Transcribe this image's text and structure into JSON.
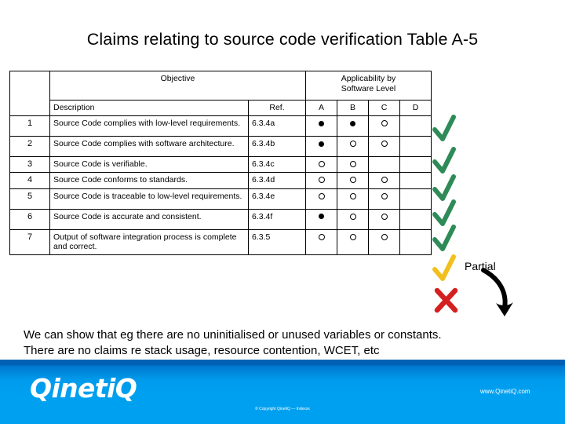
{
  "slide": {
    "title": "Claims relating to source code verification Table A-5"
  },
  "table": {
    "group_headers": {
      "objective": "Objective",
      "applicability_line1": "Applicability by",
      "applicability_line2": "Software Level"
    },
    "sub_headers": {
      "num": "",
      "description": "Description",
      "ref": "Ref.",
      "a": "A",
      "b": "B",
      "c": "C",
      "d": "D"
    },
    "rows": [
      {
        "num": "1",
        "description": "Source Code complies with low-level requirements.",
        "ref": "6.3.4a",
        "a": "filled",
        "b": "filled",
        "c": "open",
        "d": "none",
        "mark": "tick-green"
      },
      {
        "num": "2",
        "description": "Source Code complies with software architecture.",
        "ref": "6.3.4b",
        "a": "filled",
        "b": "open",
        "c": "open",
        "d": "none",
        "mark": "tick-green"
      },
      {
        "num": "3",
        "description": "Source Code is verifiable.",
        "ref": "6.3.4c",
        "a": "open",
        "b": "open",
        "c": "none",
        "d": "none",
        "mark": "tick-green"
      },
      {
        "num": "4",
        "description": "Source Code conforms to standards.",
        "ref": "6.3.4d",
        "a": "open",
        "b": "open",
        "c": "open",
        "d": "none",
        "mark": "tick-green"
      },
      {
        "num": "5",
        "description": "Source Code is traceable to low-level requirements.",
        "ref": "6.3.4e",
        "a": "open",
        "b": "open",
        "c": "open",
        "d": "none",
        "mark": "tick-green"
      },
      {
        "num": "6",
        "description": "Source Code is accurate and consistent.",
        "ref": "6.3.4f",
        "a": "filled",
        "b": "open",
        "c": "open",
        "d": "none",
        "mark": "tick-yellow"
      },
      {
        "num": "7",
        "description": "Output of software integration process is complete and correct.",
        "ref": "6.3.5",
        "a": "open",
        "b": "open",
        "c": "open",
        "d": "none",
        "mark": "cross-red"
      }
    ]
  },
  "annotations": {
    "partial_label": "Partial"
  },
  "body_text": {
    "line1": "We can show that eg there are no uninitialised or unused variables or constants.",
    "line2": "There are no claims re stack usage, resource contention, WCET, etc"
  },
  "footer": {
    "logo": "QinetiQ",
    "url": "www.QinetiQ.com",
    "copyright": "© Copyright QinetiQ — Indexxx"
  },
  "colors": {
    "tick_green": "#2E8B57",
    "tick_yellow": "#F2C01E",
    "cross_red": "#D42020",
    "footer_blue_dark": "#0061B4",
    "footer_blue_light": "#00A0F0",
    "table_border": "#000000"
  }
}
